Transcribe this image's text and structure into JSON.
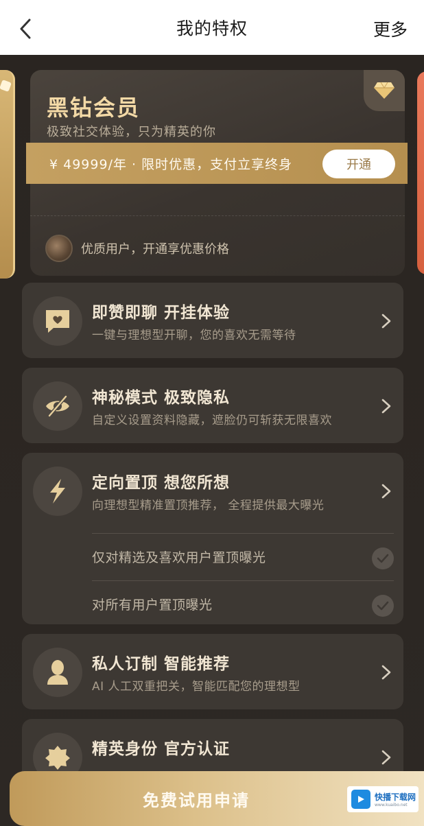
{
  "header": {
    "title": "我的特权",
    "more_label": "更多"
  },
  "member_card": {
    "title": "黑钻会员",
    "subtitle": "极致社交体验，只为精英的你",
    "price_text": "¥ 49999/年 · 限时优惠，支付立享终身",
    "open_button": "开通",
    "benefit_text": "优质用户，开通享优惠价格"
  },
  "features": [
    {
      "title": "即赞即聊 开挂体验",
      "desc": "一键与理想型开聊，您的喜欢无需等待",
      "icon": "chat-heart-icon"
    },
    {
      "title": "神秘模式 极致隐私",
      "desc": "自定义设置资料隐藏，遮脸仍可斩获无限喜欢",
      "icon": "eye-slash-icon"
    },
    {
      "title": "定向置顶 想您所想",
      "desc": "向理想型精准置顶推荐， 全程提供最大曝光",
      "icon": "lightning-icon",
      "options": [
        {
          "label": "仅对精选及喜欢用户置顶曝光"
        },
        {
          "label": "对所有用户置顶曝光"
        }
      ]
    },
    {
      "title": "私人订制 智能推荐",
      "desc": "AI 人工双重把关，智能匹配您的理想型",
      "icon": "user-icon"
    },
    {
      "title": "精英身份 官方认证",
      "desc": "",
      "icon": "badge-icon"
    }
  ],
  "bottom_button": {
    "label": "免费试用申请"
  },
  "watermark": {
    "name": "快播下载网",
    "url": "www.kuaibo.net"
  },
  "colors": {
    "gold": "#c4a061",
    "gold_light": "#f3d9a6",
    "card_bg": "#3d3833",
    "page_bg": "#2b2622"
  }
}
